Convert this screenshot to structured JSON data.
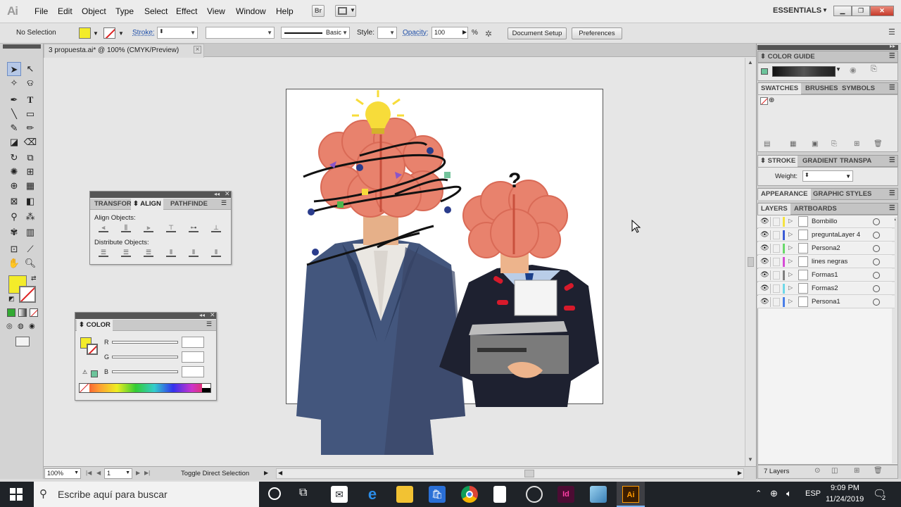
{
  "app": {
    "logo": "Ai",
    "workspace": "ESSENTIALS"
  },
  "menu": [
    "File",
    "Edit",
    "Object",
    "Type",
    "Select",
    "Effect",
    "View",
    "Window",
    "Help"
  ],
  "bridge_button": "Br",
  "control": {
    "selection": "No Selection",
    "stroke_label": "Stroke:",
    "stroke_profile": "Basic",
    "style_label": "Style:",
    "opacity_label": "Opacity:",
    "opacity_value": "100",
    "opacity_unit": "%",
    "document_setup": "Document Setup",
    "preferences": "Preferences"
  },
  "document": {
    "tab_title": "3 propuesta.ai* @ 100% (CMYK/Preview)"
  },
  "align_panel": {
    "tabs": [
      "TRANSFOR",
      "ALIGN",
      "PATHFINDE"
    ],
    "align_objects": "Align Objects:",
    "distribute_objects": "Distribute Objects:"
  },
  "color_panel": {
    "title": "COLOR",
    "r": "R",
    "g": "G",
    "b": "B"
  },
  "right": {
    "color_guide": "COLOR GUIDE",
    "swatches_tabs": [
      "SWATCHES",
      "BRUSHES",
      "SYMBOLS"
    ],
    "stroke_tabs": [
      "STROKE",
      "GRADIENT",
      "TRANSPA"
    ],
    "weight_label": "Weight:",
    "appearance_tabs": [
      "APPEARANCE",
      "GRAPHIC STYLES"
    ],
    "layers_tabs": [
      "LAYERS",
      "ARTBOARDS"
    ],
    "layers": [
      {
        "name": "Bombillo",
        "color": "#f5e340"
      },
      {
        "name": "preguntaLayer 4",
        "color": "#3b5bd6"
      },
      {
        "name": "Persona2",
        "color": "#69d96b"
      },
      {
        "name": "lines negras",
        "color": "#d64bd6"
      },
      {
        "name": "Formas1",
        "color": "#7f7f7f"
      },
      {
        "name": "Formas2",
        "color": "#6fd8e8"
      },
      {
        "name": "Persona1",
        "color": "#4a7ee8"
      }
    ],
    "layer_count": "7 Layers"
  },
  "artwork": {
    "question_mark": "?"
  },
  "status": {
    "zoom": "100%",
    "page": "1",
    "tool_hint": "Toggle Direct Selection"
  },
  "taskbar": {
    "search_placeholder": "Escribe aquí para buscar",
    "language": "ESP",
    "time": "9:09 PM",
    "date": "11/24/2019",
    "notifications": "2"
  }
}
